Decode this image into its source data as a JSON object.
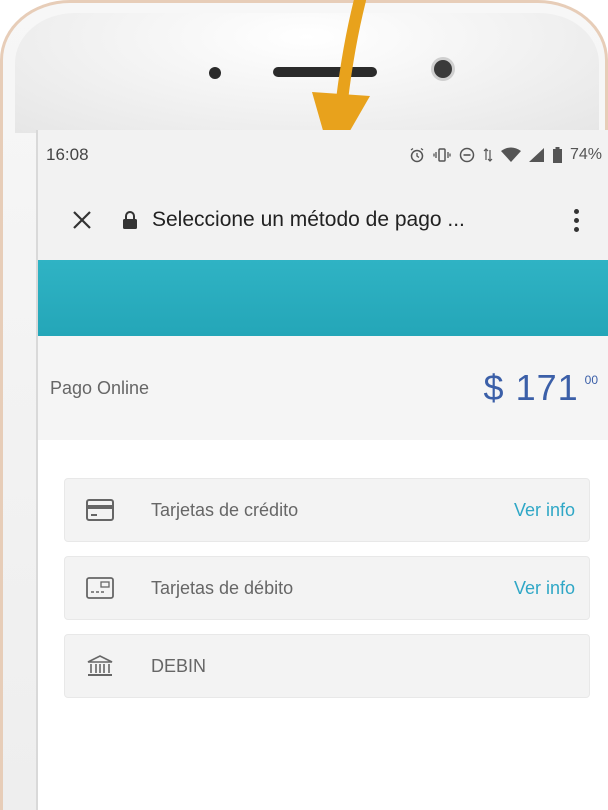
{
  "status_bar": {
    "time": "16:08",
    "battery": "74%",
    "icons": [
      "alarm-icon",
      "vibrate-icon",
      "dnd-icon",
      "data-arrows-icon",
      "wifi-icon",
      "signal-icon",
      "battery-icon"
    ]
  },
  "app_bar": {
    "title": "Seleccione un método de pago ...",
    "icons": [
      "close-icon",
      "lock-icon",
      "more-vert-icon"
    ]
  },
  "payment": {
    "label": "Pago Online",
    "amount": "$ 171",
    "cents": "00",
    "accent": "#3b5fa8"
  },
  "methods": [
    {
      "label": "Tarjetas de crédito",
      "link": "Ver info",
      "icon": "credit-card-icon"
    },
    {
      "label": "Tarjetas de débito",
      "link": "Ver info",
      "icon": "debit-card-icon"
    },
    {
      "label": "DEBIN",
      "link": "",
      "icon": "bank-icon"
    }
  ],
  "colors": {
    "banner": "#2fb3c4",
    "link": "#2fa7c6",
    "arrow": "#e8a21c"
  }
}
